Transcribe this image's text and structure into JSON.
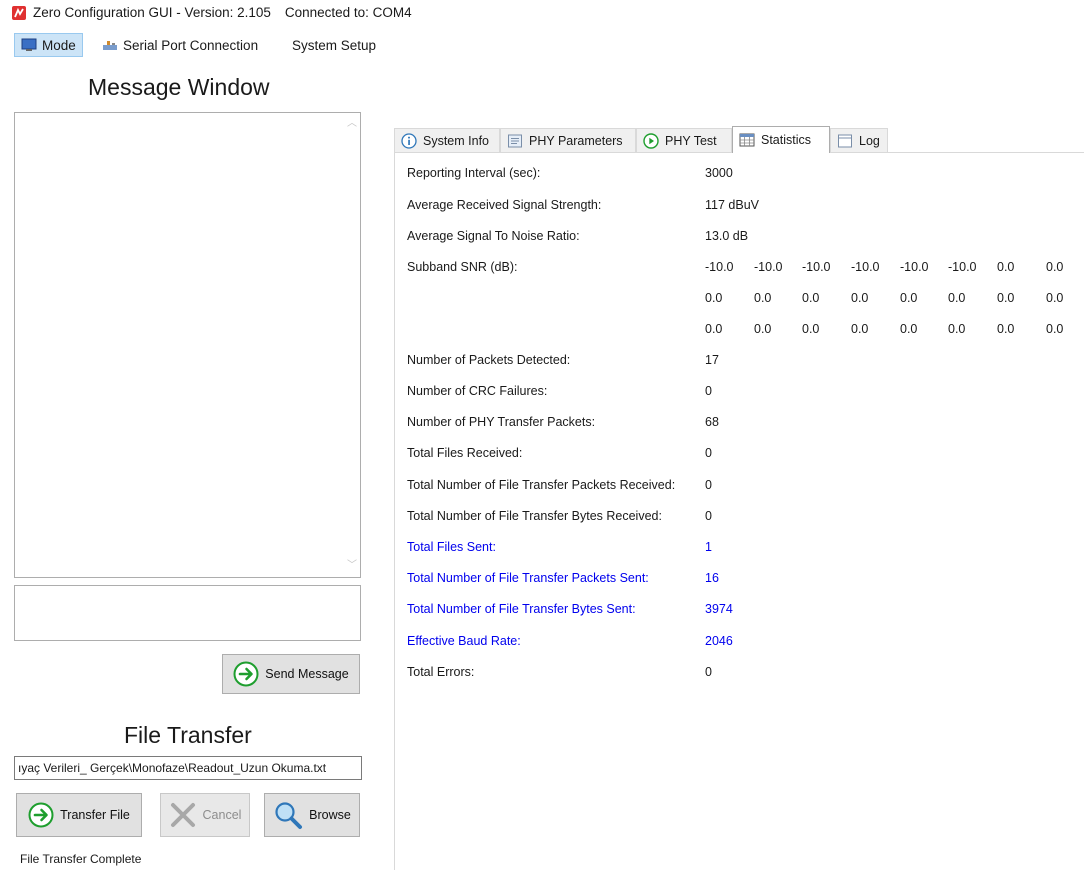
{
  "title": {
    "app": "Zero Configuration GUI - Version: 2.105",
    "connection": "Connected to: COM4"
  },
  "menu": [
    {
      "label": "Mode",
      "icon": "monitor-icon"
    },
    {
      "label": "Serial Port Connection",
      "icon": "serial-port-icon"
    },
    {
      "label": "System Setup"
    }
  ],
  "left": {
    "message_heading": "Message Window",
    "send_label": "Send Message",
    "file_heading": "File Transfer",
    "file_path": "ıyaç Verileri_ Gerçek\\Monofaze\\Readout_Uzun Okuma.txt",
    "transfer_label": "Transfer File",
    "cancel_label": "Cancel",
    "browse_label": "Browse",
    "status": "File Transfer Complete"
  },
  "tabs": [
    {
      "label": "System Info",
      "icon": "info-icon"
    },
    {
      "label": "PHY Parameters",
      "icon": "document-icon"
    },
    {
      "label": "PHY Test",
      "icon": "play-icon"
    },
    {
      "label": "Statistics",
      "icon": "table-icon",
      "selected": true
    },
    {
      "label": "Log",
      "icon": "log-icon"
    }
  ],
  "stats": {
    "reporting_interval": {
      "label": "Reporting Interval (sec):",
      "value": "3000"
    },
    "avg_rss": {
      "label": "Average Received Signal Strength:",
      "value": "117 dBuV"
    },
    "avg_snr": {
      "label": "Average Signal To Noise Ratio:",
      "value": "13.0 dB"
    },
    "subband_label": "Subband SNR (dB):",
    "subband_rows": [
      [
        "-10.0",
        "-10.0",
        "-10.0",
        "-10.0",
        "-10.0",
        "-10.0",
        "0.0",
        "0.0"
      ],
      [
        "0.0",
        "0.0",
        "0.0",
        "0.0",
        "0.0",
        "0.0",
        "0.0",
        "0.0"
      ],
      [
        "0.0",
        "0.0",
        "0.0",
        "0.0",
        "0.0",
        "0.0",
        "0.0",
        "0.0"
      ]
    ],
    "packets_detected": {
      "label": "Number of Packets Detected:",
      "value": "17"
    },
    "crc_failures": {
      "label": "Number of CRC Failures:",
      "value": "0"
    },
    "phy_transfer": {
      "label": "Number of PHY Transfer Packets:",
      "value": "68"
    },
    "files_received": {
      "label": "Total Files Received:",
      "value": "0"
    },
    "ft_packets_received": {
      "label": "Total Number of File Transfer Packets Received:",
      "value": "0"
    },
    "ft_bytes_received": {
      "label": "Total Number of File Transfer Bytes Received:",
      "value": "0"
    },
    "files_sent": {
      "label": "Total Files Sent:",
      "value": "1"
    },
    "ft_packets_sent": {
      "label": "Total Number of File Transfer Packets Sent:",
      "value": "16"
    },
    "ft_bytes_sent": {
      "label": "Total Number of File Transfer Bytes Sent:",
      "value": "3974"
    },
    "baud_rate": {
      "label": "Effective Baud Rate:",
      "value": "2046"
    },
    "total_errors": {
      "label": "Total Errors:",
      "value": "0"
    }
  },
  "colors": {
    "sent_text": "#0000ee",
    "selected_menu_bg": "#cce4f7",
    "app_icon": "#e03030",
    "arrow_icon": "#1e9e2e"
  }
}
